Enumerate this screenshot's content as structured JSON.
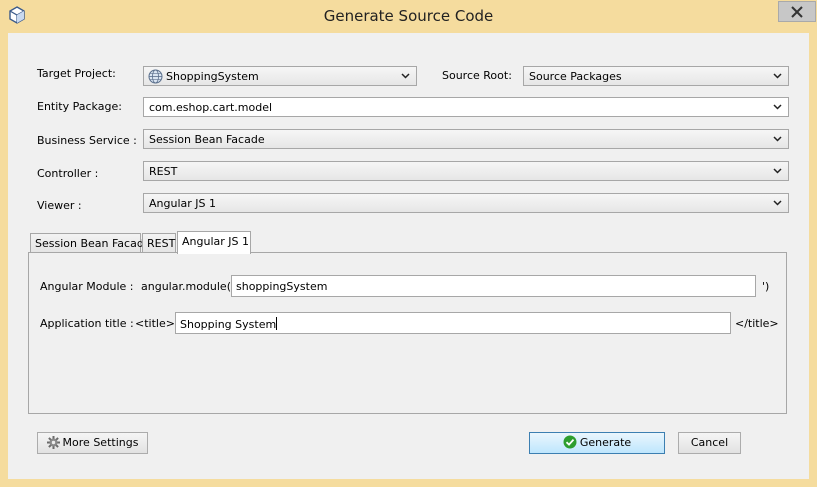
{
  "window": {
    "title": "Generate Source Code"
  },
  "form": {
    "target_project_label": "Target Project:",
    "target_project_value": "ShoppingSystem",
    "source_root_label": "Source Root:",
    "source_root_value": "Source Packages",
    "entity_package_label": "Entity Package:",
    "entity_package_value": "com.eshop.cart.model",
    "business_service_label": "Business Service :",
    "business_service_value": "Session Bean Facade",
    "controller_label": "Controller :",
    "controller_value": "REST",
    "viewer_label": "Viewer :",
    "viewer_value": "Angular JS 1"
  },
  "tabs": [
    {
      "label": "Session Bean Facade"
    },
    {
      "label": "REST"
    },
    {
      "label": "Angular JS 1"
    }
  ],
  "panel": {
    "module_label": "Angular Module :",
    "module_prefix": "angular.module('",
    "module_value": "shoppingSystem",
    "module_suffix": "')",
    "title_label": "Application title :",
    "title_prefix": "<title>",
    "title_value": "Shopping System",
    "title_suffix": "</title>"
  },
  "buttons": {
    "more_settings": "More Settings",
    "generate": "Generate",
    "cancel": "Cancel"
  },
  "colors": {
    "frame": "#f5dc9e",
    "client": "#f0f0f0",
    "default_button_border": "#3c7fb1",
    "generate_icon": "#2e9e2e"
  }
}
